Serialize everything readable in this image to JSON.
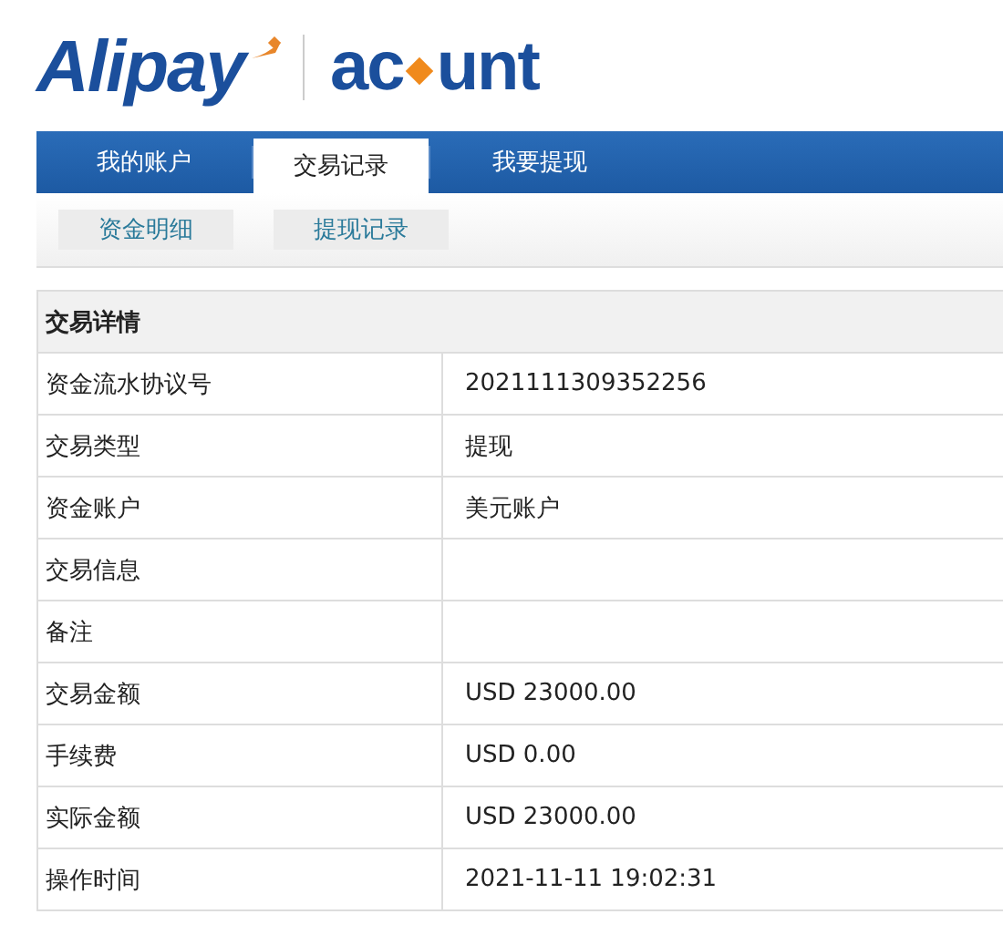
{
  "logo": {
    "brand": "Alipay",
    "product_start": "ac",
    "product_end": "unt"
  },
  "tabs": [
    {
      "label": "我的账户",
      "selected": false
    },
    {
      "label": "交易记录",
      "selected": true
    },
    {
      "label": "我要提现",
      "selected": false
    }
  ],
  "subtabs": [
    "资金明细",
    "提现记录"
  ],
  "details": {
    "title": "交易详情",
    "rows": [
      {
        "label": "资金流水协议号",
        "value": "2021111309352256"
      },
      {
        "label": "交易类型",
        "value": "提现"
      },
      {
        "label": "资金账户",
        "value": "美元账户"
      },
      {
        "label": "交易信息"
      },
      {
        "label": "备注"
      },
      {
        "label": "交易金额",
        "value": "USD 23000.00"
      },
      {
        "label": "手续费",
        "value": "USD 0.00"
      },
      {
        "label": "实际金额",
        "value": "USD 23000.00"
      },
      {
        "label": "操作时间",
        "value": "2021-11-11 19:02:31"
      }
    ]
  }
}
